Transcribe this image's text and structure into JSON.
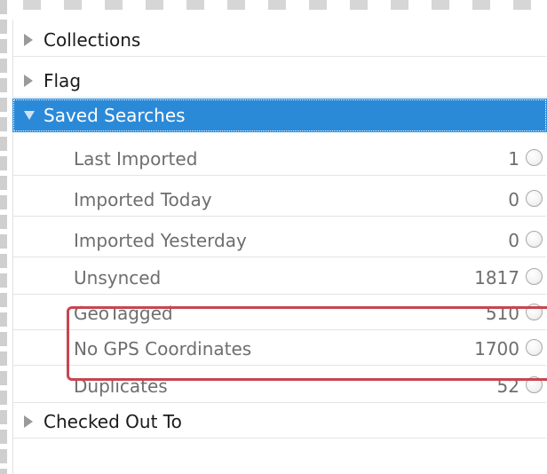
{
  "panel": {
    "sections": {
      "collections": {
        "label": "Collections"
      },
      "flag": {
        "label": "Flag"
      },
      "saved_searches": {
        "label": "Saved Searches"
      },
      "checked_out": {
        "label": "Checked Out To"
      }
    },
    "saved_searches_items": [
      {
        "label": "Last Imported",
        "count": "1"
      },
      {
        "label": "Imported Today",
        "count": "0"
      },
      {
        "label": "Imported Yesterday",
        "count": "0"
      },
      {
        "label": "Unsynced",
        "count": "1817"
      },
      {
        "label": "GeoTagged",
        "count": "510"
      },
      {
        "label": "No GPS Coordinates",
        "count": "1700"
      },
      {
        "label": "Duplicates",
        "count": "52"
      }
    ]
  },
  "colors": {
    "selection": "#2b8ad8",
    "highlight_box": "#c8454f",
    "muted_text": "#6e6e6e"
  },
  "icons": {
    "collapsed": "triangle-right-icon",
    "expanded": "triangle-down-icon",
    "radio": "radio-circle-icon"
  }
}
